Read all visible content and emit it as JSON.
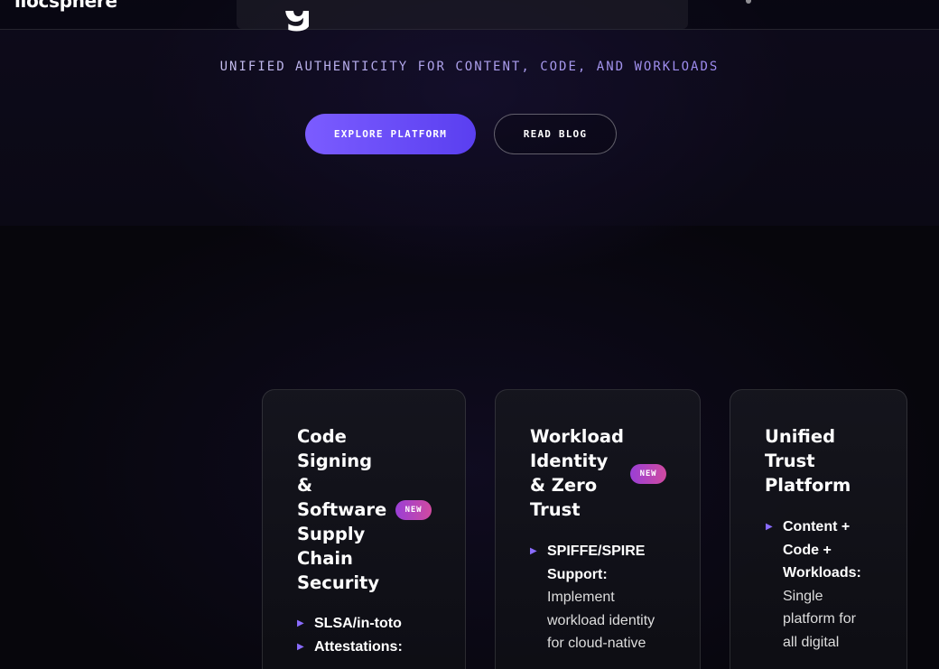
{
  "brand": {
    "logo_text": "ilocsphere"
  },
  "hero": {
    "headline_fragment": "g",
    "tagline": "UNIFIED AUTHENTICITY FOR CONTENT, CODE, AND WORKLOADS",
    "primary_button": "EXPLORE PLATFORM",
    "secondary_button": "READ BLOG"
  },
  "colors": {
    "accent": "#6b4cff",
    "badge_gradient_start": "#9a3fd6",
    "badge_gradient_end": "#d04aa0",
    "bullet": "#8a6cff",
    "background": "#07060c"
  },
  "cards": [
    {
      "title_lines": [
        "Code",
        "Signing",
        "&",
        "Software",
        "Supply",
        "Chain",
        "Security"
      ],
      "badge": "NEW",
      "items": [
        {
          "title": "SLSA/in-toto",
          "desc": ""
        },
        {
          "title": "Attestations:",
          "desc": ""
        }
      ]
    },
    {
      "title_lines": [
        "Workload",
        "Identity",
        "& Zero",
        "Trust"
      ],
      "badge": "NEW",
      "items": [
        {
          "title": "SPIFFE/SPIRE Support:",
          "desc": "Implement workload identity for cloud-native"
        }
      ]
    },
    {
      "title_lines": [
        "Unified",
        "Trust",
        "Platform"
      ],
      "badge": "",
      "items": [
        {
          "title": "Content + Code + Workloads:",
          "desc": "Single platform for all digital"
        }
      ]
    }
  ]
}
